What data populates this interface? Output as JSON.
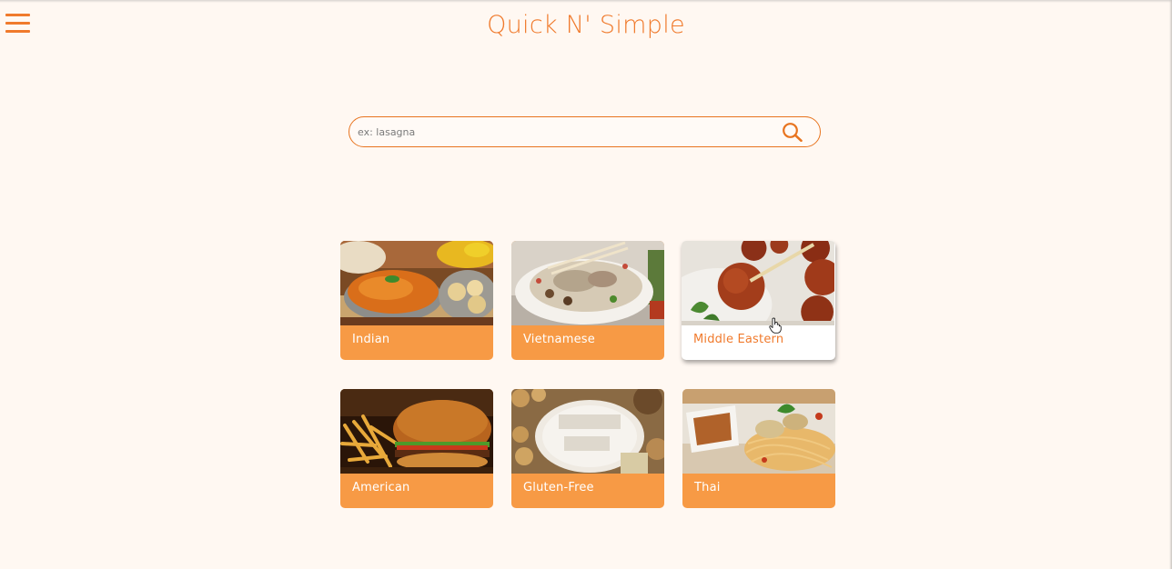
{
  "header": {
    "title": "Quick N' Simple",
    "menu_icon": "hamburger-menu-icon"
  },
  "search": {
    "placeholder": "ex: lasagna",
    "value": "",
    "icon": "search-icon"
  },
  "categories": [
    {
      "label": "Indian",
      "state": "default"
    },
    {
      "label": "Vietnamese",
      "state": "default"
    },
    {
      "label": "Middle Eastern",
      "state": "hover"
    },
    {
      "label": "American",
      "state": "default"
    },
    {
      "label": "Gluten-Free",
      "state": "default"
    },
    {
      "label": "Thai",
      "state": "default"
    }
  ],
  "colors": {
    "accent": "#f07a2c",
    "card_background": "#f79a45",
    "page_background": "#fff8f2",
    "card_hover_background": "#ffffff"
  }
}
